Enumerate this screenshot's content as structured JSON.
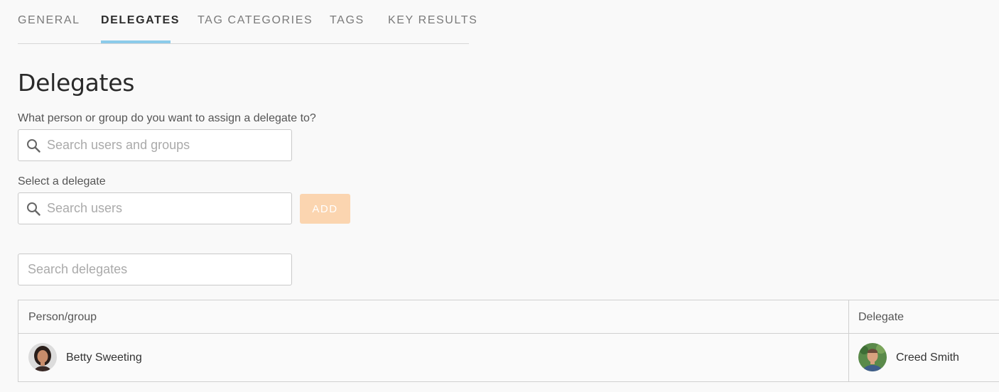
{
  "tabs": [
    {
      "label": "GENERAL",
      "active": false
    },
    {
      "label": "DELEGATES",
      "active": true
    },
    {
      "label": "TAG CATEGORIES",
      "active": false
    },
    {
      "label": "TAGS",
      "active": false
    },
    {
      "label": "KEY RESULTS",
      "active": false
    }
  ],
  "page_title": "Delegates",
  "assign": {
    "label": "What person or group do you want to assign a delegate to?",
    "placeholder": "Search users and groups",
    "value": ""
  },
  "delegate": {
    "label": "Select a delegate",
    "placeholder": "Search users",
    "value": "",
    "add_label": "ADD"
  },
  "filter": {
    "placeholder": "Search delegates",
    "value": ""
  },
  "table": {
    "columns": [
      "Person/group",
      "Delegate"
    ],
    "rows": [
      {
        "person": "Betty Sweeting",
        "delegate": "Creed Smith"
      }
    ]
  },
  "colors": {
    "accent_underline": "#8ccbea",
    "add_button_disabled": "#fbd5b0"
  }
}
